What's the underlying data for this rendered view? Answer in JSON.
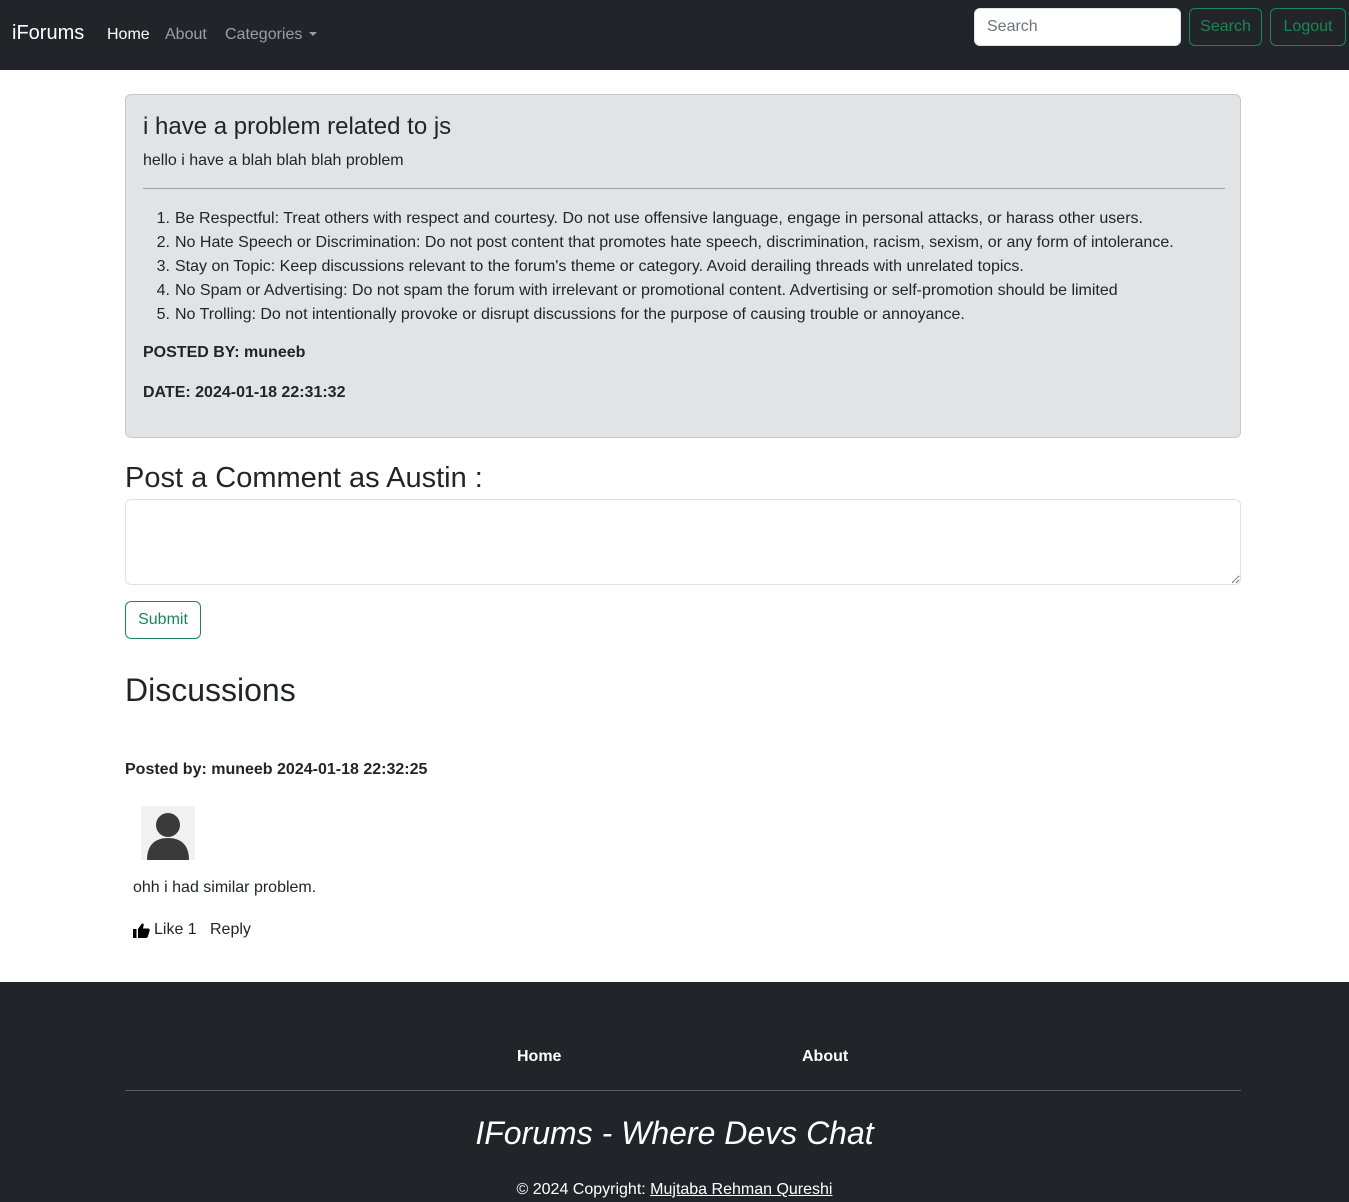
{
  "navbar": {
    "brand": "iForums",
    "links": {
      "home": "Home",
      "about": "About",
      "categories": "Categories"
    },
    "search_placeholder": "Search",
    "search_button": "Search",
    "logout_button": "Logout"
  },
  "thread": {
    "title": "i have a problem related to js",
    "description": "hello i have a blah blah blah problem",
    "rules": [
      {
        "num": "1.",
        "text": "Be Respectful: Treat others with respect and courtesy. Do not use offensive language, engage in personal attacks, or harass other users."
      },
      {
        "num": "2.",
        "text": "No Hate Speech or Discrimination: Do not post content that promotes hate speech, discrimination, racism, sexism, or any form of intolerance."
      },
      {
        "num": "3.",
        "text": "Stay on Topic: Keep discussions relevant to the forum's theme or category. Avoid derailing threads with unrelated topics."
      },
      {
        "num": "4.",
        "text": "No Spam or Advertising: Do not spam the forum with irrelevant or promotional content. Advertising or self-promotion should be limited"
      },
      {
        "num": "5.",
        "text": "No Trolling: Do not intentionally provoke or disrupt discussions for the purpose of causing trouble or annoyance."
      }
    ],
    "posted_by": "POSTED BY: muneeb",
    "date": "DATE: 2024-01-18 22:31:32"
  },
  "comment_form": {
    "heading": "Post a Comment as Austin :",
    "textarea_value": "",
    "submit_label": "Submit"
  },
  "discussions": {
    "heading": "Discussions",
    "items": [
      {
        "meta": "Posted by: muneeb 2024-01-18 22:32:25",
        "avatar_icon": "user-avatar-icon",
        "text": "ohh i had similar problem.",
        "like_label": "Like 1",
        "reply_label": "Reply"
      }
    ]
  },
  "footer": {
    "links": {
      "home": "Home",
      "about": "About"
    },
    "tagline": "IForums - Where Devs Chat",
    "copyright_prefix": "© 2024 Copyright: ",
    "author": "Mujtaba Rehman Qureshi"
  },
  "colors": {
    "navbar_bg": "#212529",
    "accent_green": "#198754",
    "thread_bg": "#e2e3e5"
  }
}
